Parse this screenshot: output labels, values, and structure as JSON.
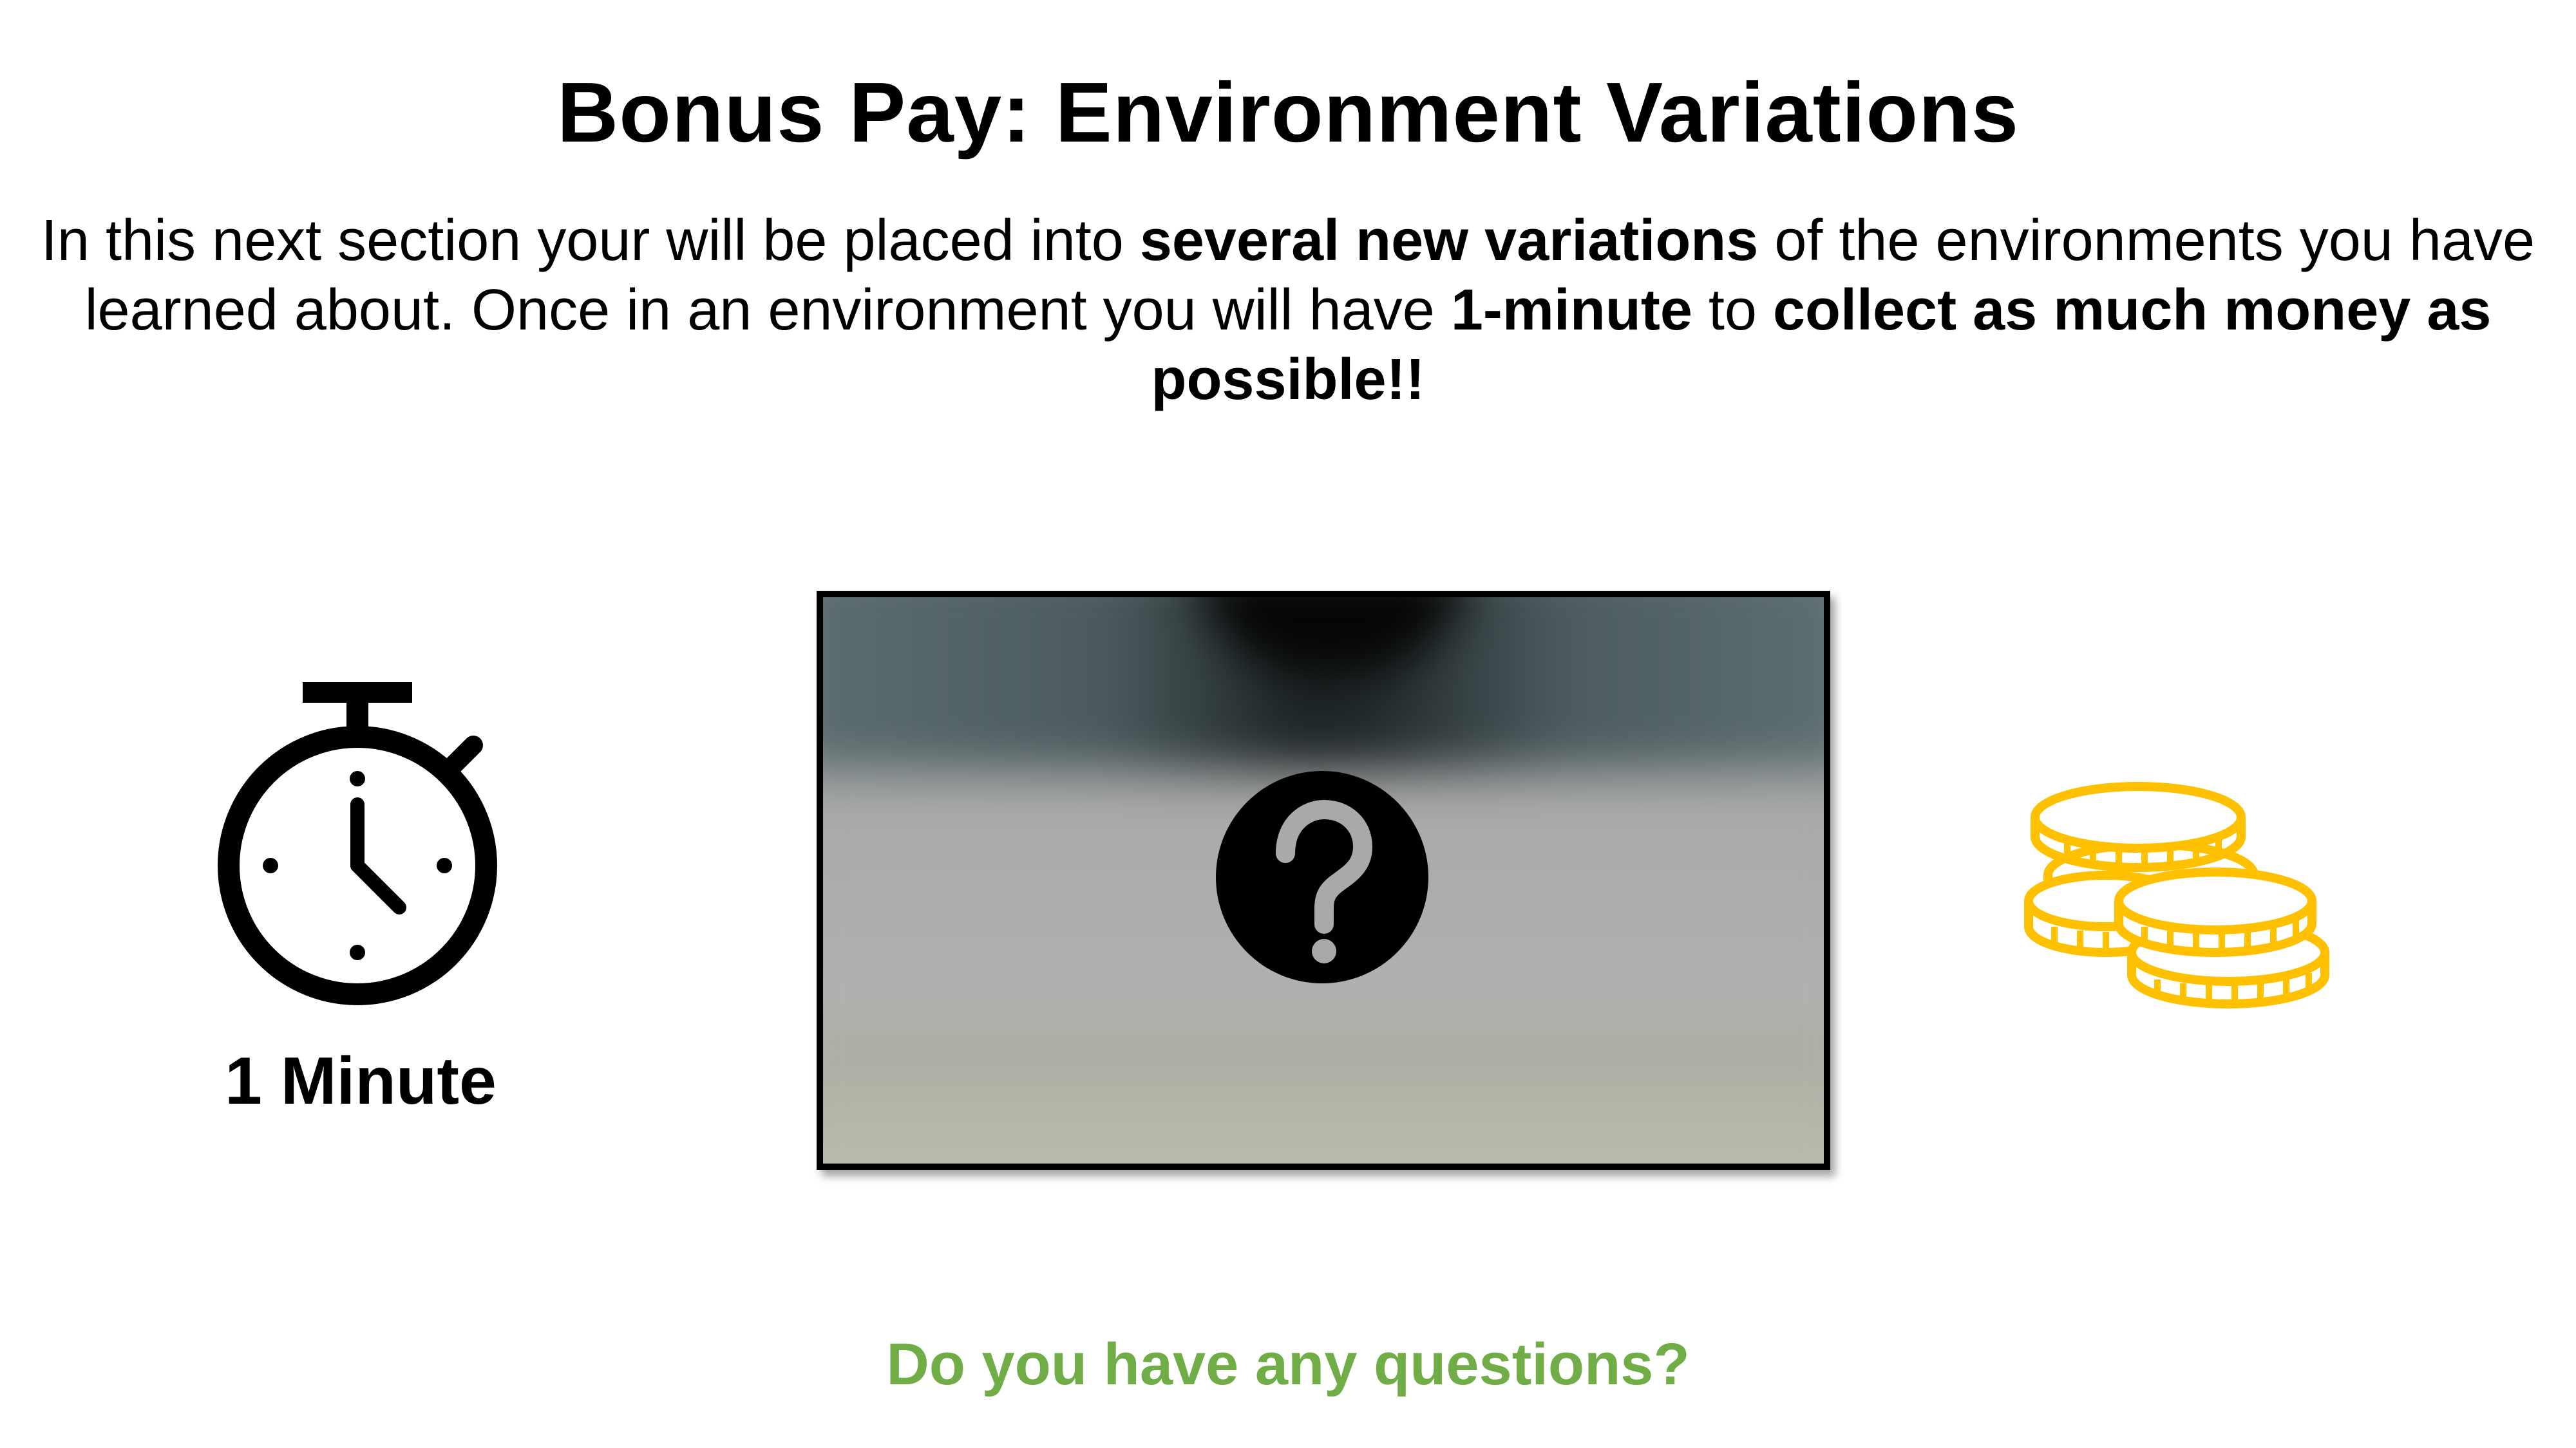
{
  "slide": {
    "title": "Bonus Pay: Environment Variations",
    "intro": {
      "p1": "In this next section your will be placed into ",
      "b1": "several new variations",
      "p2": " of the environments you have learned about. Once in an environment you will have ",
      "b2": "1-minute",
      "p3": " to ",
      "b3": "collect as much money as possible!!"
    },
    "timer_label": "1 Minute",
    "questions_prompt": "Do you have any questions?"
  },
  "icons": {
    "timer": "stopwatch-icon",
    "environment": "question-mark-icon",
    "money": "coins-icon"
  },
  "colors": {
    "questions_text": "#70ad47",
    "coins": "#ffc000",
    "icon_dark": "#000000"
  }
}
